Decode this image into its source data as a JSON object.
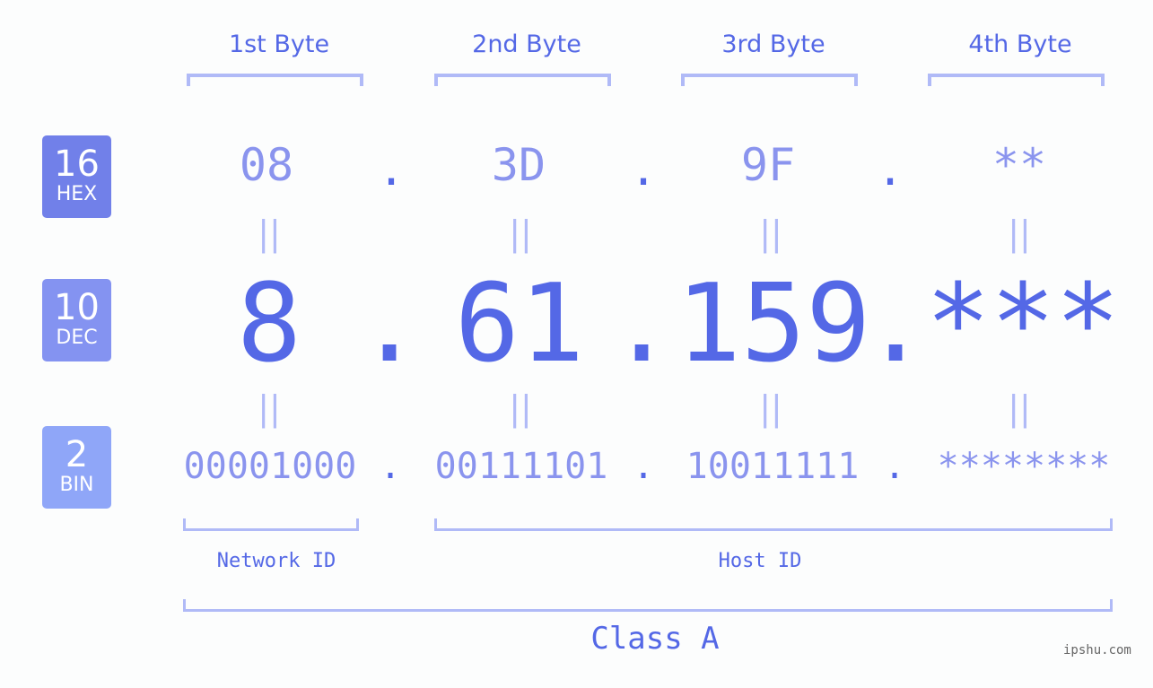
{
  "ip": "8.61.159.***",
  "badges": [
    {
      "base": "16",
      "name": "HEX",
      "color": "#7180e9"
    },
    {
      "base": "10",
      "name": "DEC",
      "color": "#8493f1"
    },
    {
      "base": "2",
      "name": "BIN",
      "color": "#8fa6f8"
    }
  ],
  "byte_labels": [
    "1st Byte",
    "2nd Byte",
    "3rd Byte",
    "4th Byte"
  ],
  "hex": [
    "08",
    "3D",
    "9F",
    "**"
  ],
  "dec": [
    "8",
    "61",
    "159",
    "***"
  ],
  "bin": [
    "00001000",
    "00111101",
    "10011111",
    "********"
  ],
  "separator": ".",
  "equals": "||",
  "network_label": "Network ID",
  "host_label": "Host ID",
  "class_label": "Class A",
  "watermark": "ipshu.com",
  "colors": {
    "accent": "#5468e6",
    "light": "#8a94ee",
    "bracket": "#b0baf7"
  }
}
